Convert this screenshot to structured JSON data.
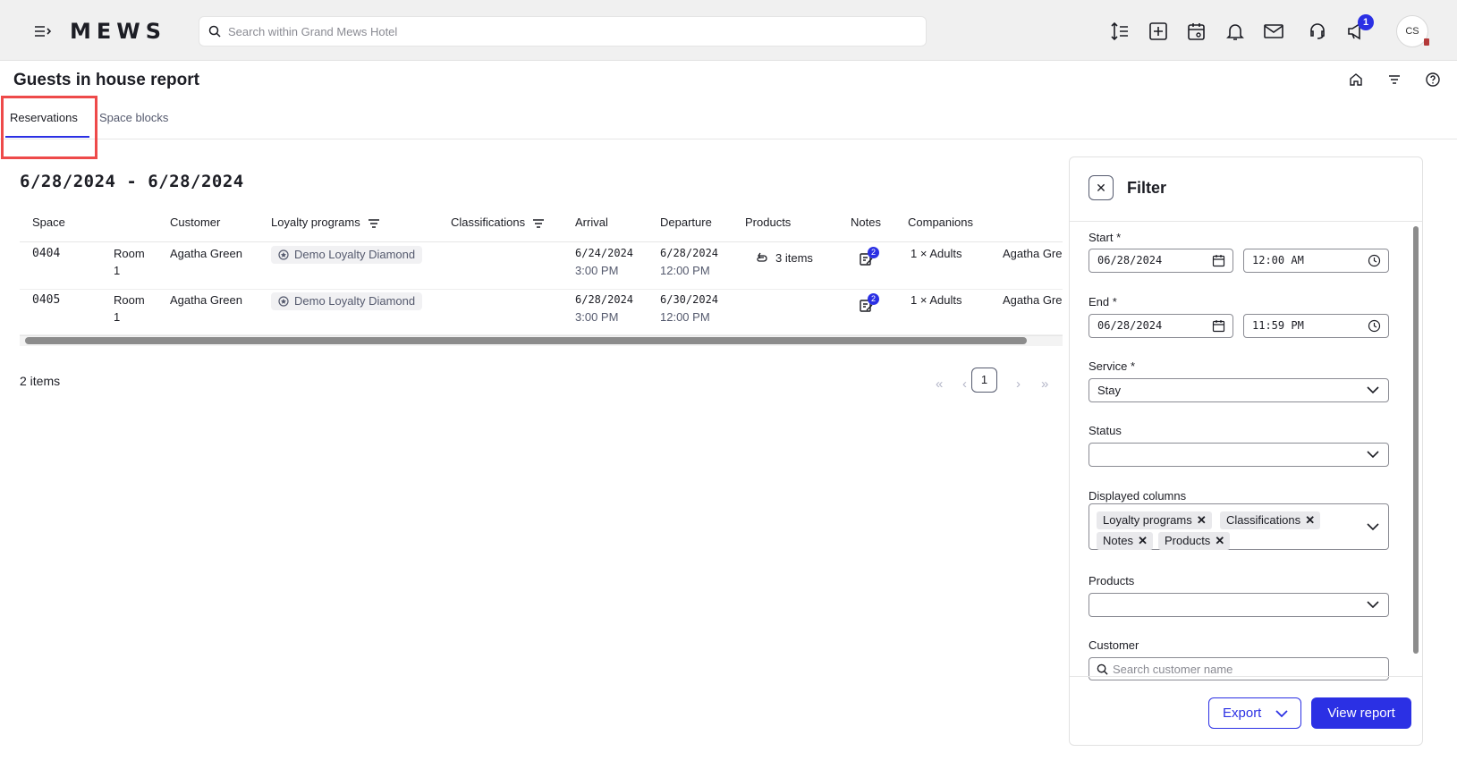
{
  "app": {
    "logo": "MEWS"
  },
  "search": {
    "placeholder": "Search within Grand Mews Hotel"
  },
  "topbar": {
    "notification_count": "1",
    "avatar_initials": "CS"
  },
  "page": {
    "title": "Guests in house report"
  },
  "tabs": [
    {
      "label": "Reservations",
      "active": true
    },
    {
      "label": "Space blocks",
      "active": false
    }
  ],
  "report": {
    "date_range": "6/28/2024 - 6/28/2024",
    "columns": [
      "Space",
      "Customer",
      "Loyalty programs",
      "Classifications",
      "Arrival",
      "Departure",
      "Products",
      "Notes",
      "Companions"
    ],
    "rows": [
      {
        "space": "0404",
        "room_type": "Room",
        "room_num": "1",
        "customer": "Agatha Green",
        "loyalty": "Demo Loyalty Diamond",
        "arrival_date": "6/24/2024",
        "arrival_time": "3:00 PM",
        "departure_date": "6/28/2024",
        "departure_time": "12:00 PM",
        "products": "3 items",
        "notes_count": "2",
        "companions": "1 × Adults",
        "companion_name": "Agatha Gre"
      },
      {
        "space": "0405",
        "room_type": "Room",
        "room_num": "1",
        "customer": "Agatha Green",
        "loyalty": "Demo Loyalty Diamond",
        "arrival_date": "6/28/2024",
        "arrival_time": "3:00 PM",
        "departure_date": "6/30/2024",
        "departure_time": "12:00 PM",
        "products": "",
        "notes_count": "2",
        "companions": "1 × Adults",
        "companion_name": "Agatha Gre"
      }
    ],
    "item_count": "2 items",
    "pagination": {
      "current_page": "1",
      "first": "«",
      "prev": "‹",
      "next": "›",
      "last": "»"
    }
  },
  "filter": {
    "title": "Filter",
    "close": "✕",
    "start_label": "Start *",
    "start_date": "06/28/2024",
    "start_time": "12:00 AM",
    "end_label": "End *",
    "end_date": "06/28/2024",
    "end_time": "11:59 PM",
    "service_label": "Service *",
    "service_value": "Stay",
    "status_label": "Status",
    "status_value": "",
    "columns_label": "Displayed columns",
    "displayed_columns": [
      "Loyalty programs",
      "Classifications",
      "Notes",
      "Products"
    ],
    "products_label": "Products",
    "products_value": "",
    "customer_label": "Customer",
    "customer_placeholder": "Search customer name",
    "export_label": "Export",
    "view_report_label": "View report"
  },
  "colors": {
    "accent": "#2b30e4",
    "highlight": "#ee4a4a"
  },
  "icons": [
    "hamburger-icon",
    "search-icon",
    "sort-icon",
    "add-icon",
    "calendar-eye-icon",
    "bell-icon",
    "mail-icon",
    "support-icon",
    "announcement-icon",
    "home-icon",
    "filter-icon",
    "help-icon",
    "loyalty-badge-icon",
    "products-icon",
    "notes-icon",
    "calendar-icon",
    "clock-icon",
    "chevron-down-icon",
    "close-icon"
  ]
}
